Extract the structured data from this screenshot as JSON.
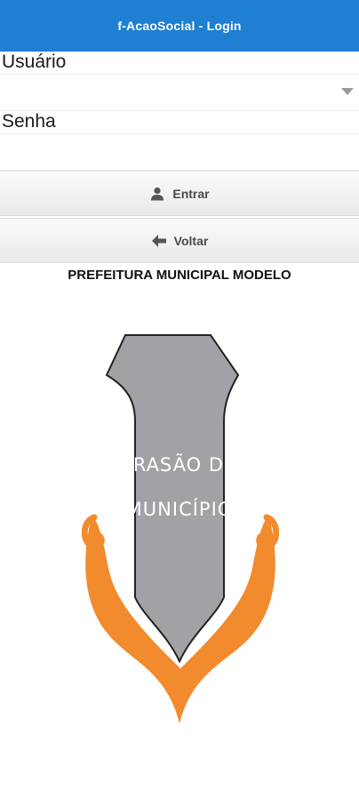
{
  "header": {
    "title": "f-AcaoSocial - Login"
  },
  "form": {
    "user_label": "Usuário",
    "user_value": "",
    "password_label": "Senha",
    "password_value": ""
  },
  "buttons": {
    "login_label": "Entrar",
    "login_icon": "user-icon",
    "back_label": "Voltar",
    "back_icon": "arrow-left-icon"
  },
  "org": {
    "name": "PREFEITURA MUNICIPAL MODELO",
    "crest_text_line1": "BRASÃO DO",
    "crest_text_line2": "MUNICÍPIO"
  },
  "colors": {
    "header_bg": "#1f7fd1",
    "crest_shield": "#a1a2a5",
    "crest_ribbon": "#f28a2e"
  }
}
